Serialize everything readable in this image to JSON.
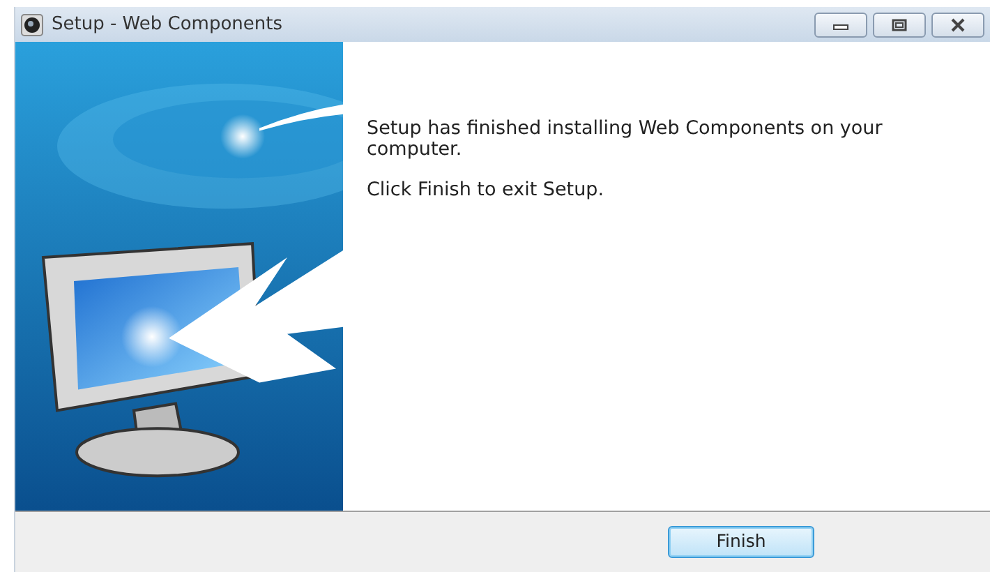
{
  "window": {
    "title": "Setup - Web Components"
  },
  "messages": [
    "Setup has finished installing Web Components on your computer.",
    "Click Finish to exit Setup."
  ],
  "buttons": [
    {
      "label": "Finish",
      "default": true
    }
  ]
}
